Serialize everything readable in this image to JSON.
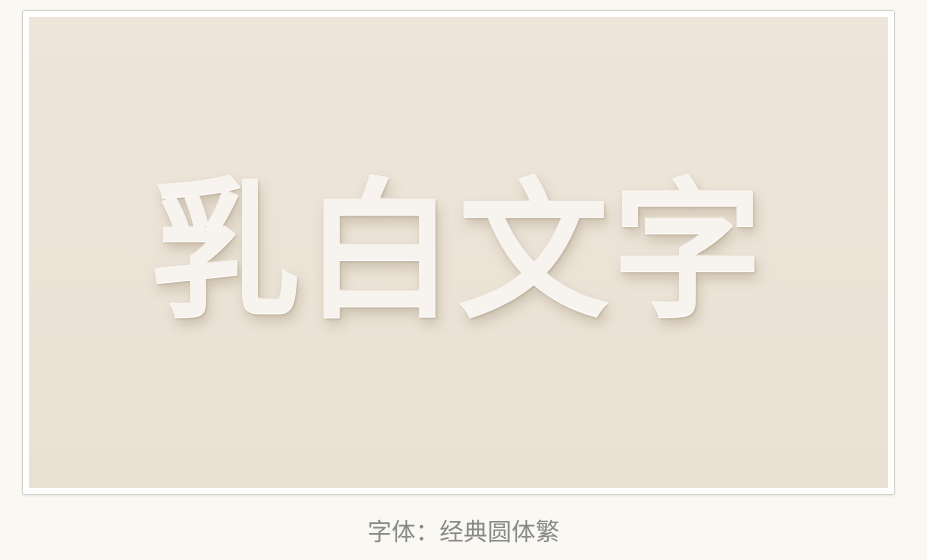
{
  "preview": {
    "sample_text": "乳白文字"
  },
  "caption": {
    "text": "字体：经典圆体繁"
  },
  "colors": {
    "page_background": "#faf8f2",
    "canvas_background": "#ebe3d6",
    "text_color": "#f7f3ee",
    "caption_color": "#888888"
  }
}
